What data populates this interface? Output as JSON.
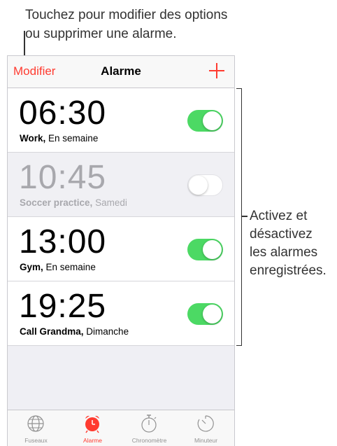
{
  "callouts": {
    "top_line1": "Touchez pour modifier des options",
    "top_line2": "ou supprimer une alarme.",
    "right_line1": "Activez et",
    "right_line2": "désactivez",
    "right_line3": "les alarmes",
    "right_line4": "enregistrées."
  },
  "navbar": {
    "edit_label": "Modifier",
    "title": "Alarme",
    "add_icon": "plus-icon"
  },
  "alarms": [
    {
      "time": "06:30",
      "name": "Work,",
      "repeat": "En semaine",
      "enabled": true
    },
    {
      "time": "10:45",
      "name": "Soccer practice,",
      "repeat": "Samedi",
      "enabled": false
    },
    {
      "time": "13:00",
      "name": "Gym,",
      "repeat": "En semaine",
      "enabled": true
    },
    {
      "time": "19:25",
      "name": "Call Grandma,",
      "repeat": "Dimanche",
      "enabled": true
    }
  ],
  "tabbar": {
    "tabs": [
      {
        "label": "Fuseaux",
        "icon": "globe-icon",
        "active": false
      },
      {
        "label": "Alarme",
        "icon": "alarm-clock-icon",
        "active": true
      },
      {
        "label": "Chronomètre",
        "icon": "stopwatch-icon",
        "active": false
      },
      {
        "label": "Minuteur",
        "icon": "timer-icon",
        "active": false
      }
    ]
  },
  "colors": {
    "accent": "#ff3b30",
    "toggle_on": "#4cd964",
    "inactive_text": "#a8a8ad",
    "tab_inactive": "#929292"
  }
}
